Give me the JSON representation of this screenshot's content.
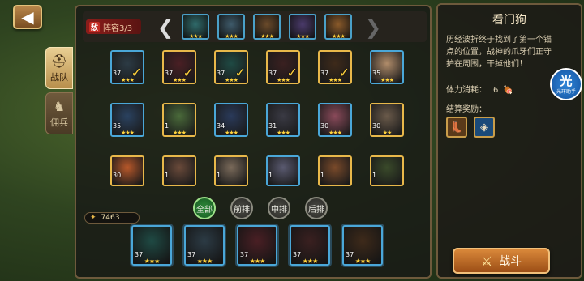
{
  "nav": {
    "back_icon": "back-arrow-icon",
    "tabs": [
      {
        "label": "战队",
        "icon": "helmet-icon",
        "active": true
      },
      {
        "label": "佣兵",
        "icon": "mercenary-icon",
        "active": false
      }
    ]
  },
  "lineup": {
    "enemy_tag": "敌",
    "label": "阵容3/3",
    "enemies": [
      {
        "stars": "★★★",
        "color": "#2f6a6a"
      },
      {
        "stars": "★★★",
        "color": "#3e5a6a"
      },
      {
        "stars": "★★★",
        "color": "#6a4a2a"
      },
      {
        "stars": "★★★",
        "color": "#4a3a6a"
      },
      {
        "stars": "★★★",
        "color": "#8a5a2a"
      }
    ]
  },
  "roster": [
    {
      "level": "37",
      "stars": "★★★",
      "check": "✓",
      "border": "blue",
      "color": "#2c3b45"
    },
    {
      "level": "37",
      "stars": "★★★",
      "check": "✓",
      "border": "gold",
      "color": "#4a1f24"
    },
    {
      "level": "37",
      "stars": "★★★",
      "check": "✓",
      "border": "gold",
      "color": "#1f4a44"
    },
    {
      "level": "37",
      "stars": "★★★",
      "check": "✓",
      "border": "gold",
      "color": "#3a2020"
    },
    {
      "level": "37",
      "stars": "★★★",
      "check": "✓",
      "border": "gold",
      "color": "#3e2a1a"
    },
    {
      "level": "35",
      "stars": "★★★",
      "check": "",
      "border": "blue",
      "color": "#b08c6a"
    },
    {
      "level": "35",
      "stars": "★★★",
      "check": "",
      "border": "blue",
      "color": "#2a4260"
    },
    {
      "level": "1",
      "stars": "★★★",
      "check": "",
      "border": "gold",
      "color": "#4a6a3a"
    },
    {
      "level": "34",
      "stars": "★★★",
      "check": "",
      "border": "blue",
      "color": "#2a3a5a"
    },
    {
      "level": "31",
      "stars": "★★★",
      "check": "",
      "border": "blue",
      "color": "#3a3a44"
    },
    {
      "level": "30",
      "stars": "★★★",
      "check": "",
      "border": "blue",
      "color": "#8a4a5a"
    },
    {
      "level": "30",
      "stars": "★★",
      "check": "",
      "border": "gold",
      "color": "#6a5a4a"
    },
    {
      "level": "30",
      "stars": "",
      "check": "",
      "border": "gold",
      "color": "#b8582a"
    },
    {
      "level": "1",
      "stars": "",
      "check": "",
      "border": "gold",
      "color": "#6a4a3a"
    },
    {
      "level": "1",
      "stars": "",
      "check": "",
      "border": "gold",
      "color": "#7a6a5a"
    },
    {
      "level": "1",
      "stars": "",
      "check": "",
      "border": "blue",
      "color": "#5a5a70"
    },
    {
      "level": "1",
      "stars": "",
      "check": "",
      "border": "gold",
      "color": "#7a4a2a"
    },
    {
      "level": "1",
      "stars": "",
      "check": "",
      "border": "gold",
      "color": "#3a4a2a"
    }
  ],
  "filters": [
    {
      "label": "全部",
      "active": true
    },
    {
      "label": "前排",
      "active": false
    },
    {
      "label": "中排",
      "active": false
    },
    {
      "label": "后排",
      "active": false
    }
  ],
  "power": {
    "icon": "paw-icon",
    "value": "7463"
  },
  "team": [
    {
      "level": "37",
      "stars": "★★★",
      "color": "#1f4a44"
    },
    {
      "level": "37",
      "stars": "★★★",
      "color": "#2c3b45"
    },
    {
      "level": "37",
      "stars": "★★★",
      "color": "#4a1f24"
    },
    {
      "level": "37",
      "stars": "★★★",
      "color": "#3a2020"
    },
    {
      "level": "37",
      "stars": "★★★",
      "color": "#3e2a1a"
    }
  ],
  "stage": {
    "title": "看门狗",
    "description": "历经波折终于找到了第一个锚点的位置，战神的爪牙们正守护在周围，干掉他们！",
    "stamina_label": "体力消耗：",
    "stamina_value": "6",
    "reward_label": "结算奖励：",
    "rewards": [
      {
        "icon": "boots-icon",
        "glyph": "👢",
        "color": "#5a3a1a"
      },
      {
        "icon": "blue-gem-icon",
        "glyph": "◈",
        "color": "#1a4a7a"
      }
    ],
    "badge_big": "光",
    "badge_small": "光环助手",
    "fight_label": "战斗"
  }
}
